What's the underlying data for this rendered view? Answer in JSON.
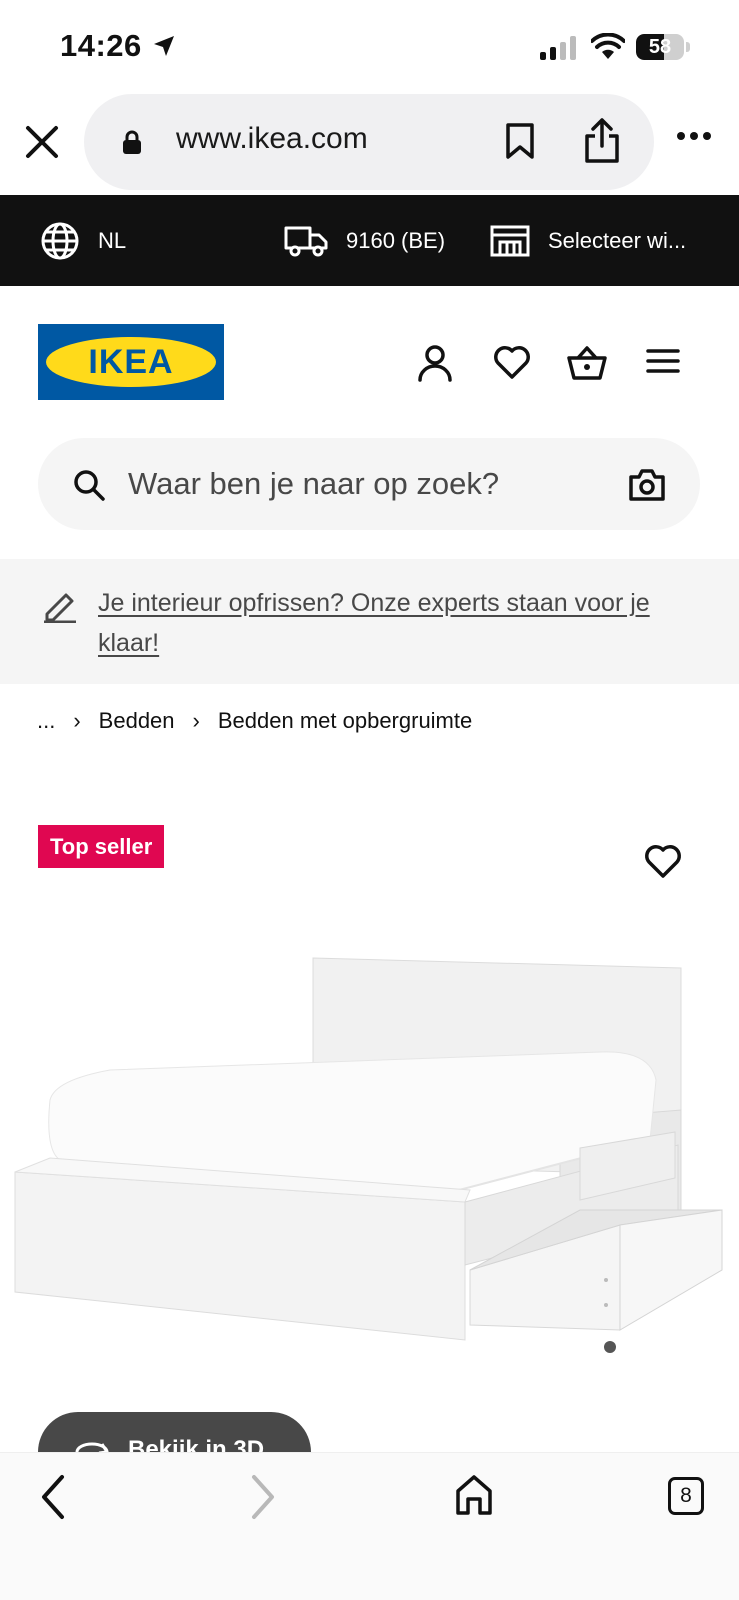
{
  "status": {
    "time": "14:26",
    "battery": "58",
    "battery_level": 0.58
  },
  "browser": {
    "url": "www.ikea.com",
    "tab_count": "8"
  },
  "top_bar": {
    "language": "NL",
    "delivery": "9160 (BE)",
    "store": "Selecteer wi..."
  },
  "logo": {
    "text": "IKEA"
  },
  "search": {
    "placeholder": "Waar ben je naar op zoek?"
  },
  "banner": {
    "text": "Je interieur opfrissen? Onze experts staan voor je klaar!"
  },
  "breadcrumb": {
    "ellipsis": "...",
    "items": [
      "Bedden",
      "Bedden met opbergruimte"
    ]
  },
  "product": {
    "badge": "Top seller",
    "view_3d": "Bekijk in 3D"
  },
  "colors": {
    "top_bar": "#111111",
    "badge": "#e00751",
    "logo_blue": "#0058a3",
    "logo_yellow": "#ffda1a"
  }
}
